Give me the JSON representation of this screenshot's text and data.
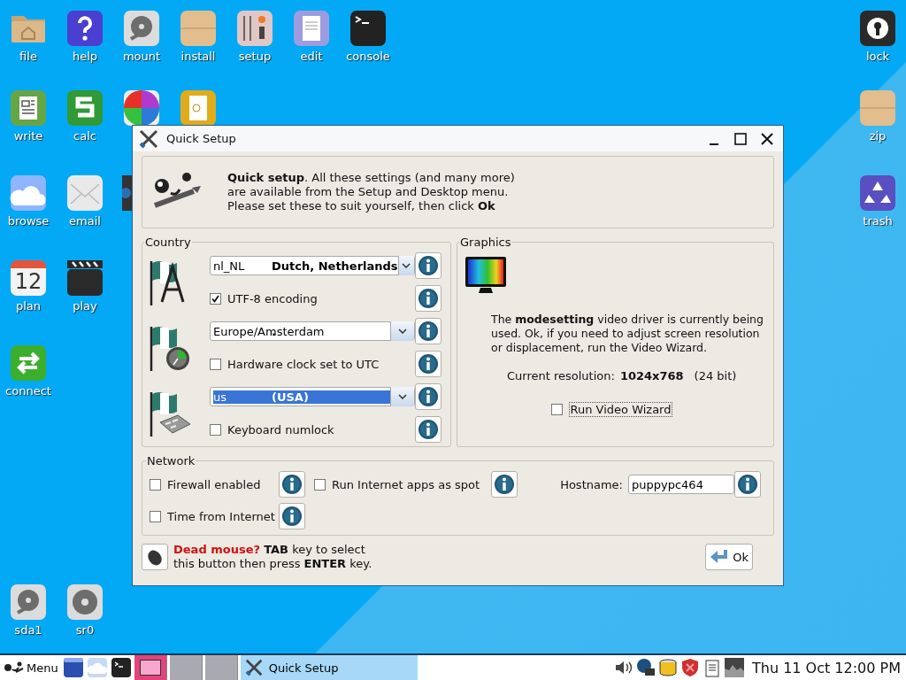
{
  "desktop": {
    "left_rows": [
      [
        {
          "label": "file"
        },
        {
          "label": "help"
        },
        {
          "label": "mount"
        },
        {
          "label": "install"
        },
        {
          "label": "setup"
        },
        {
          "label": "edit"
        },
        {
          "label": "console"
        }
      ],
      [
        {
          "label": "write"
        },
        {
          "label": "calc"
        }
      ],
      [
        {
          "label": "browse"
        },
        {
          "label": "email"
        }
      ],
      [
        {
          "label": "plan",
          "icon_text": "12"
        },
        {
          "label": "play"
        }
      ],
      [
        {
          "label": "connect"
        }
      ]
    ],
    "right_column": [
      {
        "label": "lock"
      },
      {
        "label": "zip"
      },
      {
        "label": "trash"
      }
    ],
    "drives": [
      {
        "label": "sda1"
      },
      {
        "label": "sr0"
      }
    ]
  },
  "window": {
    "title": "Quick Setup",
    "intro": "**Quick setup**. All these settings (and many more)\nare available from the Setup and Desktop menu.\nPlease set these to suit yourself, then click **Ok**",
    "country": {
      "title": "Country",
      "locale": {
        "code": "nl_NL",
        "name": "Dutch, Netherlands",
        "text_selected": false
      },
      "utf8": {
        "label": "UTF-8 encoding",
        "checked": true
      },
      "timezone": {
        "code": "Europe/Amsterdam",
        "name": ".",
        "text_selected": false
      },
      "hwclock": {
        "label": "Hardware clock set to UTC",
        "checked": false
      },
      "keyboard": {
        "code": "us",
        "name": "(USA)",
        "text_selected": true
      },
      "numlock": {
        "label": "Keyboard numlock",
        "checked": false
      }
    },
    "graphics": {
      "title": "Graphics",
      "description": "The **modesetting** video driver is currently being\nused. Ok, if you need to adjust screen resolution\nor displacement, run the Video Wizard.",
      "resolution_label": "Current resolution:",
      "resolution": "1024x768",
      "depth": "(24 bit)",
      "wizard": {
        "label": "Run Video Wizard",
        "checked": false
      }
    },
    "network": {
      "title": "Network",
      "firewall": {
        "label": "Firewall enabled",
        "checked": false
      },
      "spot": {
        "label": "Run Internet apps as spot",
        "checked": false
      },
      "hostname_label": "Hostname:",
      "hostname": "puppypc464",
      "time": {
        "label": "Time from Internet",
        "checked": false
      }
    },
    "hint": "**Dead mouse?** **TAB** key to select\nthis button then press **ENTER** key.",
    "ok": "Ok"
  },
  "taskbar": {
    "menu": "Menu",
    "pager": [
      {
        "selected": true
      },
      {
        "selected": false
      },
      {
        "selected": false
      }
    ],
    "tasks": [
      {
        "label": "Quick Setup",
        "selected": true
      }
    ],
    "clock": "Thu 11 Oct 12:00 PM"
  }
}
